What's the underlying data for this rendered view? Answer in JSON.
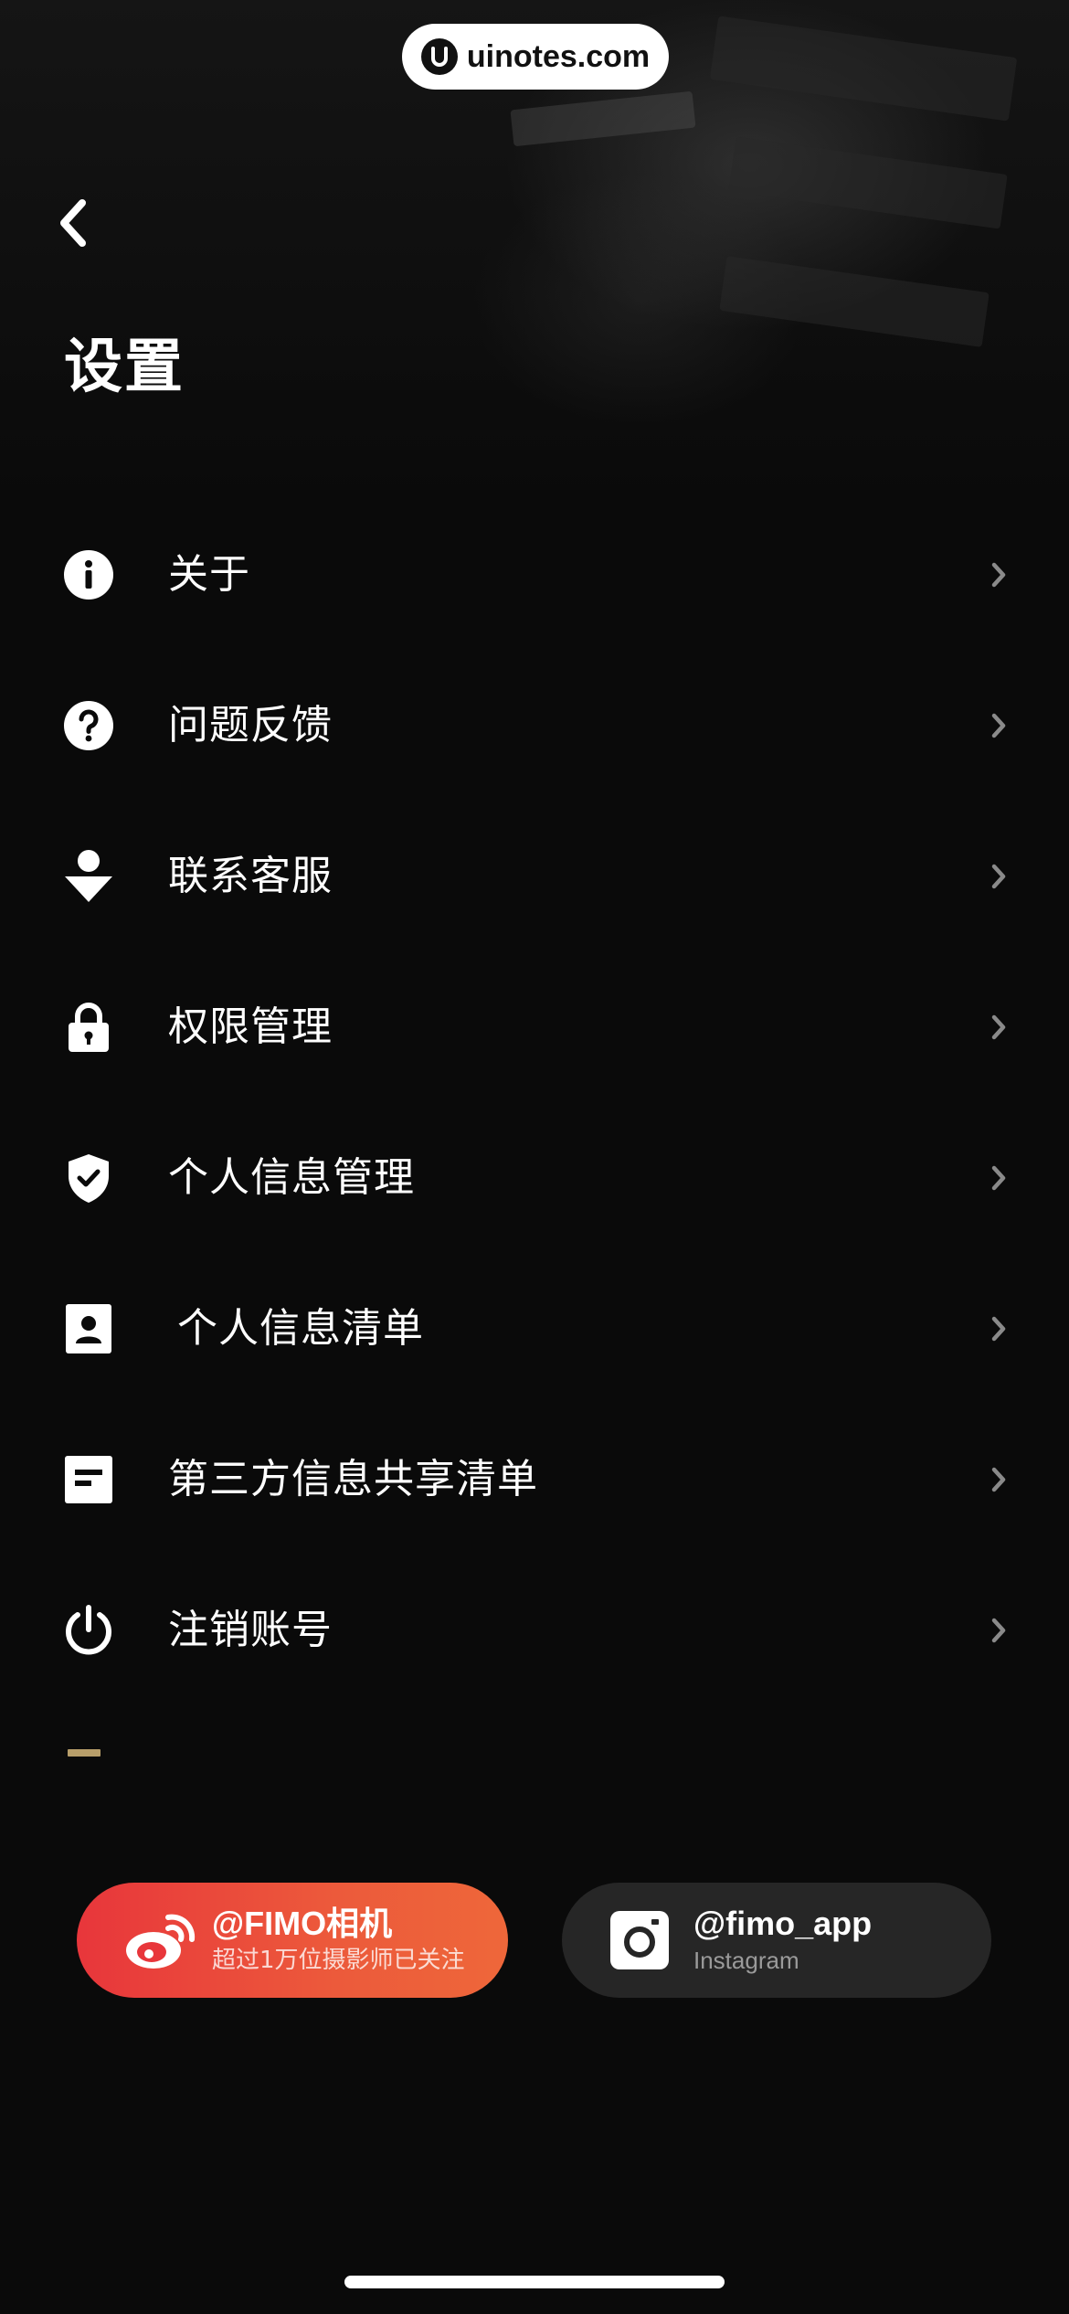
{
  "watermark": {
    "text": "uinotes.com"
  },
  "header": {
    "title": "设置"
  },
  "menu": {
    "items": [
      {
        "label": "关于",
        "icon": "info-icon"
      },
      {
        "label": "问题反馈",
        "icon": "question-icon"
      },
      {
        "label": "联系客服",
        "icon": "customer-service-icon"
      },
      {
        "label": "权限管理",
        "icon": "lock-icon"
      },
      {
        "label": "个人信息管理",
        "icon": "shield-check-icon"
      },
      {
        "label": "个人信息清单",
        "icon": "contact-card-icon"
      },
      {
        "label": "第三方信息共享清单",
        "icon": "document-list-icon"
      },
      {
        "label": "注销账号",
        "icon": "power-icon"
      }
    ]
  },
  "social": {
    "weibo": {
      "handle": "@FIMO相机",
      "subtitle": "超过1万位摄影师已关注",
      "icon": "weibo-icon"
    },
    "instagram": {
      "handle": "@fimo_app",
      "subtitle": "Instagram",
      "icon": "instagram-icon"
    }
  },
  "colors": {
    "background": "#0a0a0a",
    "accent_mark": "#b79e6a",
    "weibo_gradient_start": "#e8363b",
    "weibo_gradient_end": "#ee673a",
    "instagram_pill": "#262626",
    "chevron": "#8a8a8a"
  }
}
